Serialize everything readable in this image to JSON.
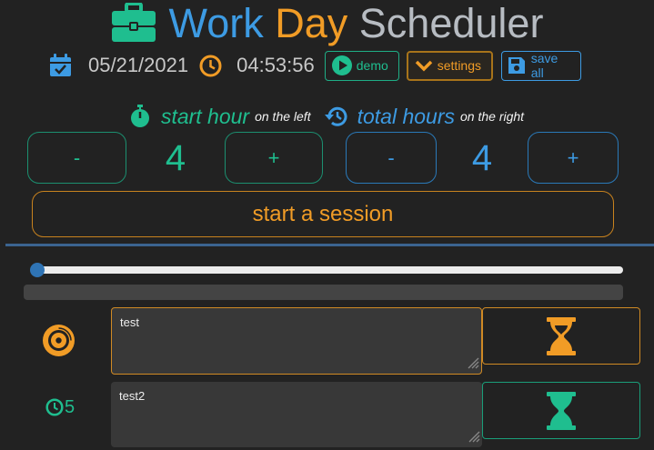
{
  "title": {
    "word1": "Work",
    "word2": "Day",
    "word3": "Scheduler"
  },
  "colors": {
    "blue": "#3d9be3",
    "orange": "#f19c26",
    "green": "#1fbe8f",
    "grey_text": "#b7bcc2",
    "background": "#222222"
  },
  "clock": {
    "date": "05/21/2021",
    "time": "04:53:56"
  },
  "toolbar": {
    "demo_label": "demo",
    "settings_label": "settings",
    "save_label": "save all"
  },
  "session": {
    "start_hour_label": "start hour",
    "start_hour_hint": "on the left",
    "total_hours_label": "total hours",
    "total_hours_hint": "on the right",
    "start_hour_value": "4",
    "total_hours_value": "4",
    "decrement_label": "-",
    "increment_label": "+",
    "start_button_label": "start a session"
  },
  "slider": {
    "value_fraction": 0.0
  },
  "progress": {
    "value_fraction": 0.0
  },
  "tasks": [
    {
      "text": "test",
      "status_icon": "vinyl-record-icon",
      "timer_icon": "hourglass-icon",
      "accent": "#f19c26"
    },
    {
      "text": "test2",
      "status_icon": "clock-icon",
      "duration": "5",
      "timer_icon": "hourglass-icon",
      "accent": "#1fbe8f"
    }
  ],
  "icons": {
    "title": "briefcase-icon",
    "date": "calendar-check-icon",
    "time": "clock-icon",
    "demo": "play-circle-icon",
    "settings": "chevron-down-icon",
    "save": "floppy-disk-icon",
    "start_hour": "stopwatch-icon",
    "total_hours": "history-icon"
  }
}
